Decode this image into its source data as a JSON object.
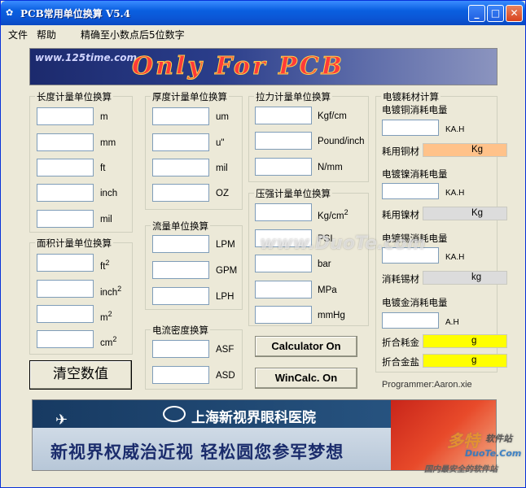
{
  "window": {
    "title": "PCB常用单位换算 V5.4",
    "controls": {
      "minimize": "_",
      "maximize": "□",
      "close": "✕"
    }
  },
  "menu": {
    "file": "文件",
    "help": "帮助",
    "precision": "精确至小数点后5位数字"
  },
  "banner_top": {
    "url": "www.125time.com",
    "slogan": "Only For PCB"
  },
  "length": {
    "title": "长度计量单位换算",
    "units": [
      "m",
      "mm",
      "ft",
      "inch",
      "mil"
    ]
  },
  "thickness": {
    "title": "厚度计量单位换算",
    "units": [
      "um",
      "u\"",
      "mil",
      "OZ"
    ]
  },
  "tension": {
    "title": "拉力计量单位换算",
    "units": [
      "Kgf/cm",
      "Pound/inch",
      "N/mm"
    ]
  },
  "area": {
    "title": "面积计量单位换算",
    "units": [
      {
        "base": "ft",
        "exp": "2"
      },
      {
        "base": "inch",
        "exp": "2"
      },
      {
        "base": "m",
        "exp": "2"
      },
      {
        "base": "cm",
        "exp": "2"
      }
    ]
  },
  "flow": {
    "title": "流量单位换算",
    "units": [
      "LPM",
      "GPM",
      "LPH"
    ]
  },
  "pressure": {
    "title": "压强计量单位换算",
    "units": [
      {
        "base": "Kg/cm",
        "exp": "2"
      },
      {
        "base": "PSI",
        "exp": ""
      },
      {
        "base": "bar",
        "exp": ""
      },
      {
        "base": "MPa",
        "exp": ""
      },
      {
        "base": "mmHg",
        "exp": ""
      }
    ]
  },
  "current_density": {
    "title": "电流密度换算",
    "units": [
      "ASF",
      "ASD"
    ]
  },
  "plating": {
    "title": "电镀耗材计算",
    "copper": {
      "label": "电镀铜消耗电量",
      "unit": "KA.H",
      "material_label": "耗用铜材",
      "material_unit": "Kg",
      "color": "#ffc28a"
    },
    "nickel": {
      "label": "电镀镍消耗电量",
      "unit": "KA.H",
      "material_label": "耗用镍材",
      "material_unit": "Kg",
      "color": "#dcdcdc"
    },
    "tin": {
      "label": "电镀锡消耗电量",
      "unit": "KA.H",
      "material_label": "消耗锡材",
      "material_unit": "kg",
      "color": "#dcdcdc"
    },
    "gold": {
      "label": "电镀金消耗电量",
      "unit": "A.H",
      "gold_label": "折合耗金",
      "gold_unit": "g",
      "salt_label": "折合金盐",
      "salt_unit": "g",
      "color": "#ffff00"
    }
  },
  "buttons": {
    "clear": "清空数值",
    "calculator": "Calculator On",
    "wincalc": "WinCalc. On"
  },
  "credit": "Programmer:Aaron.xie",
  "banner_bottom": {
    "hospital": "上海新视界眼科医院",
    "slogan": "新视界权威治近视 轻松圆您参军梦想"
  },
  "watermarks": {
    "center": "www.DuoTe.com",
    "corner_brand": "多特",
    "corner_site": "软件站",
    "corner_url": "DuoTe.Com",
    "corner_bottom": "国内最安全的软件站"
  }
}
